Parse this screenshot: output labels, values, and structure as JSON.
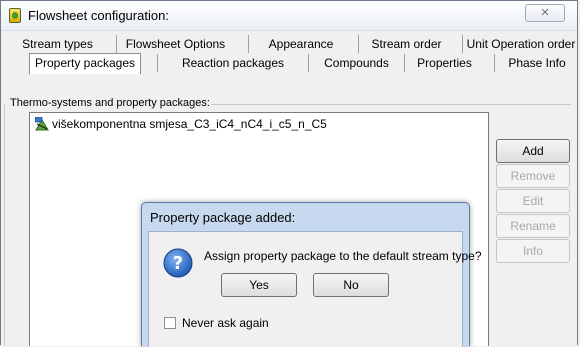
{
  "window": {
    "title": "Flowsheet configuration:",
    "close_glyph": "✕"
  },
  "tabs_row1": [
    {
      "label": "Stream types"
    },
    {
      "label": "Flowsheet Options"
    },
    {
      "label": "Appearance"
    },
    {
      "label": "Stream order"
    },
    {
      "label": "Unit Operation order"
    }
  ],
  "tabs_row2": [
    {
      "label": "Property packages",
      "selected": true
    },
    {
      "label": "Reaction packages"
    },
    {
      "label": "Compounds"
    },
    {
      "label": "Properties"
    },
    {
      "label": "Phase Info"
    }
  ],
  "group": {
    "label": "Thermo-systems and property packages:"
  },
  "list": {
    "items": [
      {
        "label": "višekomponentna smjesa_C3_iC4_nC4_i_c5_n_C5",
        "icon": "property-package-icon"
      }
    ]
  },
  "side_buttons": [
    {
      "label": "Add",
      "enabled": true
    },
    {
      "label": "Remove",
      "enabled": false
    },
    {
      "label": "Edit",
      "enabled": false
    },
    {
      "label": "Rename",
      "enabled": false
    },
    {
      "label": "Info",
      "enabled": false
    }
  ],
  "dialog": {
    "title": "Property package added:",
    "message": "Assign property package to the default stream type?",
    "icon": "question-icon",
    "yes_label": "Yes",
    "no_label": "No",
    "checkbox_label": "Never ask again",
    "checkbox_checked": false
  },
  "colors": {
    "dialog_frame": "#c7d9ee",
    "question_icon": "#2c6fcb"
  }
}
